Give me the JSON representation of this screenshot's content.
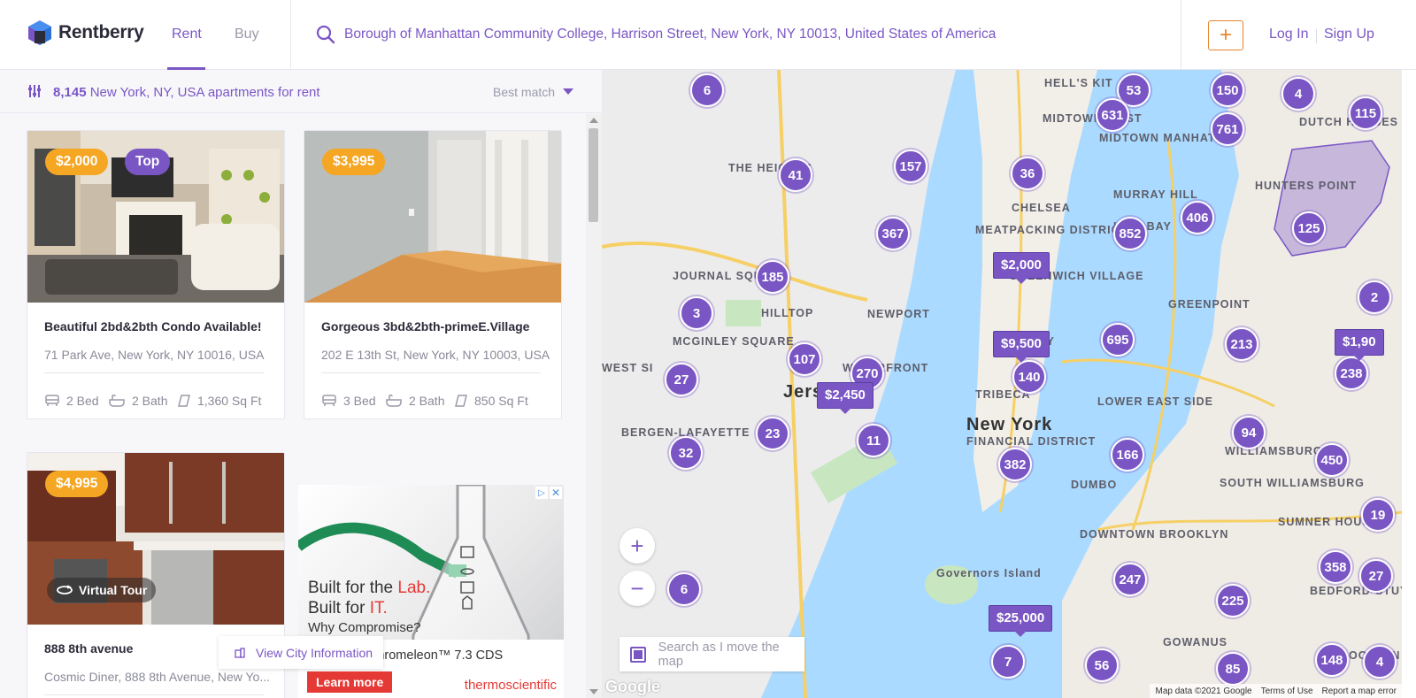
{
  "header": {
    "logo_text": "Rentberry",
    "tabs": [
      {
        "label": "Rent"
      },
      {
        "label": "Buy"
      }
    ],
    "search_value": "Borough of Manhattan Community College, Harrison Street, New York, NY 10013, United States of America",
    "add_label": "+",
    "login": "Log In",
    "signup": "Sign Up"
  },
  "results": {
    "count": "8,145",
    "location_text": "New York, NY, USA apartments for rent",
    "sort_label": "Best match"
  },
  "listings": [
    {
      "price": "$2,000",
      "tag": "Top",
      "title": "Beautiful 2bd&2bth Condo Available!",
      "address": "71 Park Ave, New York, NY 10016, USA",
      "beds": "2 Bed",
      "baths": "2 Bath",
      "sqft": "1,360 Sq Ft"
    },
    {
      "price": "$3,995",
      "title": "Gorgeous 3bd&2bth-primeE.Village",
      "address": "202 E 13th St, New York, NY 10003, USA",
      "beds": "3 Bed",
      "baths": "2 Bath",
      "sqft": "850 Sq Ft"
    },
    {
      "price": "$4,995",
      "tag": "Virtual Tour",
      "title": "888 8th avenue",
      "address": "Cosmic Diner, 888 8th Avenue, New Yo..."
    }
  ],
  "ad": {
    "line1_a": "Built for the ",
    "line1_b": "Lab.",
    "line2_a": "Built for ",
    "line2_b": "IT.",
    "line3": "Why Compromise?",
    "line4": "cientific™ Chromeleon™ 7.3 CDS",
    "cta": "Learn more",
    "brand": "thermoscientific"
  },
  "city_info": "View City Information",
  "map": {
    "search_as_move": "Search as I move the map",
    "zoom_in": "+",
    "zoom_out": "−",
    "google": "Google",
    "footer": [
      "Map data ©2021 Google",
      "Terms of Use",
      "Report a map error"
    ],
    "clusters": [
      "6",
      "53",
      "150",
      "4",
      "115",
      "631",
      "761",
      "41",
      "157",
      "36",
      "406",
      "367",
      "852",
      "125",
      "185",
      "3",
      "2",
      "107",
      "270",
      "695",
      "213",
      "27",
      "140",
      "238",
      "23",
      "11",
      "382",
      "166",
      "94",
      "450",
      "32",
      "19",
      "6",
      "247",
      "225",
      "358",
      "27",
      "7",
      "56",
      "85",
      "148",
      "4"
    ],
    "price_pins": [
      "$2,000",
      "$9,500",
      "$2,450",
      "$25,000",
      "$1,90"
    ],
    "labels": [
      "HELL'S KIT",
      "MIDTOWN WEST",
      "MIDTOWN MANHATTAN",
      "THE HEIGHTS",
      "CHELSEA",
      "MURRAY HILL",
      "HUNTERS POINT",
      "MEATPACKING DISTRICT",
      "KIPS BAY",
      "JOURNAL SQUARE",
      "GREENWICH VILLAGE",
      "HILLTOP",
      "NEWPORT",
      "GREENPOINT",
      "MCGINLEY SQUARE",
      "BOWERY",
      "WEST SI",
      "WATERFRONT",
      "TRIBECA",
      "LOWER EAST SIDE",
      "New York",
      "Jers",
      "BERGEN-LAFAYETTE",
      "FINANCIAL DISTRICT",
      "WILLIAMSBURG",
      "SOUTH WILLIAMSBURG",
      "DUMBO",
      "DOWNTOWN BROOKLYN",
      "Governors Island",
      "SUMNER HOUSES",
      "BEDFORD-STUYVE",
      "DUTCH HOUSES",
      "GOWANUS",
      "BROOKLYN"
    ]
  }
}
